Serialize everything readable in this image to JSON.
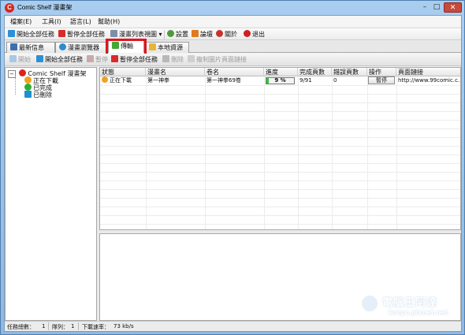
{
  "window": {
    "title": "Comic Shelf 漫畫架",
    "app_icon_letter": "C",
    "controls": {
      "minimize": "–",
      "maximize": "□",
      "close": "✕"
    }
  },
  "menu": [
    "檔案(E)",
    "工具(I)",
    "語言(L)",
    "幫助(H)"
  ],
  "toolbar": {
    "start_all": "開始全部任務",
    "pause_all": "暫停全部任務",
    "hidden": "漫畫列表視圖",
    "settings": "設置",
    "forum": "論壇",
    "about": "關於",
    "exit": "退出"
  },
  "tabs": [
    "最新信息",
    "漫畫瀏覽器",
    "傳輸",
    "本地資源"
  ],
  "active_tab": "傳輸",
  "subtoolbar": {
    "start": "開始",
    "start_all": "開始全部任務",
    "pause": "暫停",
    "pause_all": "暫停全部任務",
    "delete": "刪除",
    "copy_url": "複制圖片頁面鏈接"
  },
  "tree": {
    "root": "Comic Shelf 漫畫架",
    "children": [
      "正在下載",
      "已完成",
      "已刪除"
    ]
  },
  "grid": {
    "columns": [
      "狀態",
      "漫畫名",
      "卷名",
      "進度",
      "完成頁數",
      "錯誤頁數",
      "操作",
      "頁面鏈接"
    ],
    "rows": [
      {
        "status": "正在下載",
        "comic": "第一神拳",
        "volume": "第一神拳69卷",
        "progress_label": "9 %",
        "progress": 0.09,
        "done_pages": "9/91",
        "error_pages": "0",
        "action": "暫停",
        "link": "http://www.99comic.c..."
      }
    ]
  },
  "status": {
    "total_label": "任務總數：",
    "total_value": "1",
    "queue_label": "隊列：",
    "queue_value": "1",
    "speed_label": "下載速率：",
    "speed_value": "73 kb/s"
  },
  "watermark": {
    "line1": "電腦王阿達",
    "line2": "kocpc.pixnet.net"
  },
  "colors": {
    "accent_red": "#d7261e",
    "highlight_box": "#e0141e",
    "progress_green": "#33c23a"
  }
}
